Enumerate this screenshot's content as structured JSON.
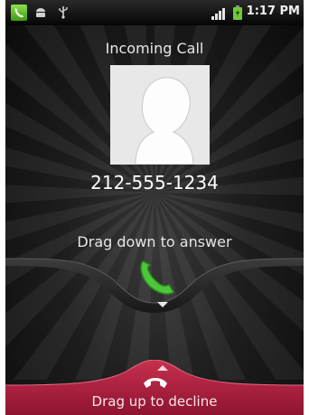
{
  "status_bar": {
    "time": "1:17 PM",
    "icons": [
      "call-notification-icon",
      "android-debug-icon",
      "usb-icon",
      "signal-icon",
      "battery-icon"
    ],
    "notification_color": "#5bc02a",
    "battery_color": "#72c83a"
  },
  "call": {
    "title": "Incoming Call",
    "number": "212-555-1234"
  },
  "answer": {
    "label": "Drag down to answer",
    "icon": "phone-handset-icon",
    "color": "#4cc63a"
  },
  "decline": {
    "label": "Drag up to decline",
    "icon": "hang-up-icon",
    "color": "#b11f3f"
  }
}
